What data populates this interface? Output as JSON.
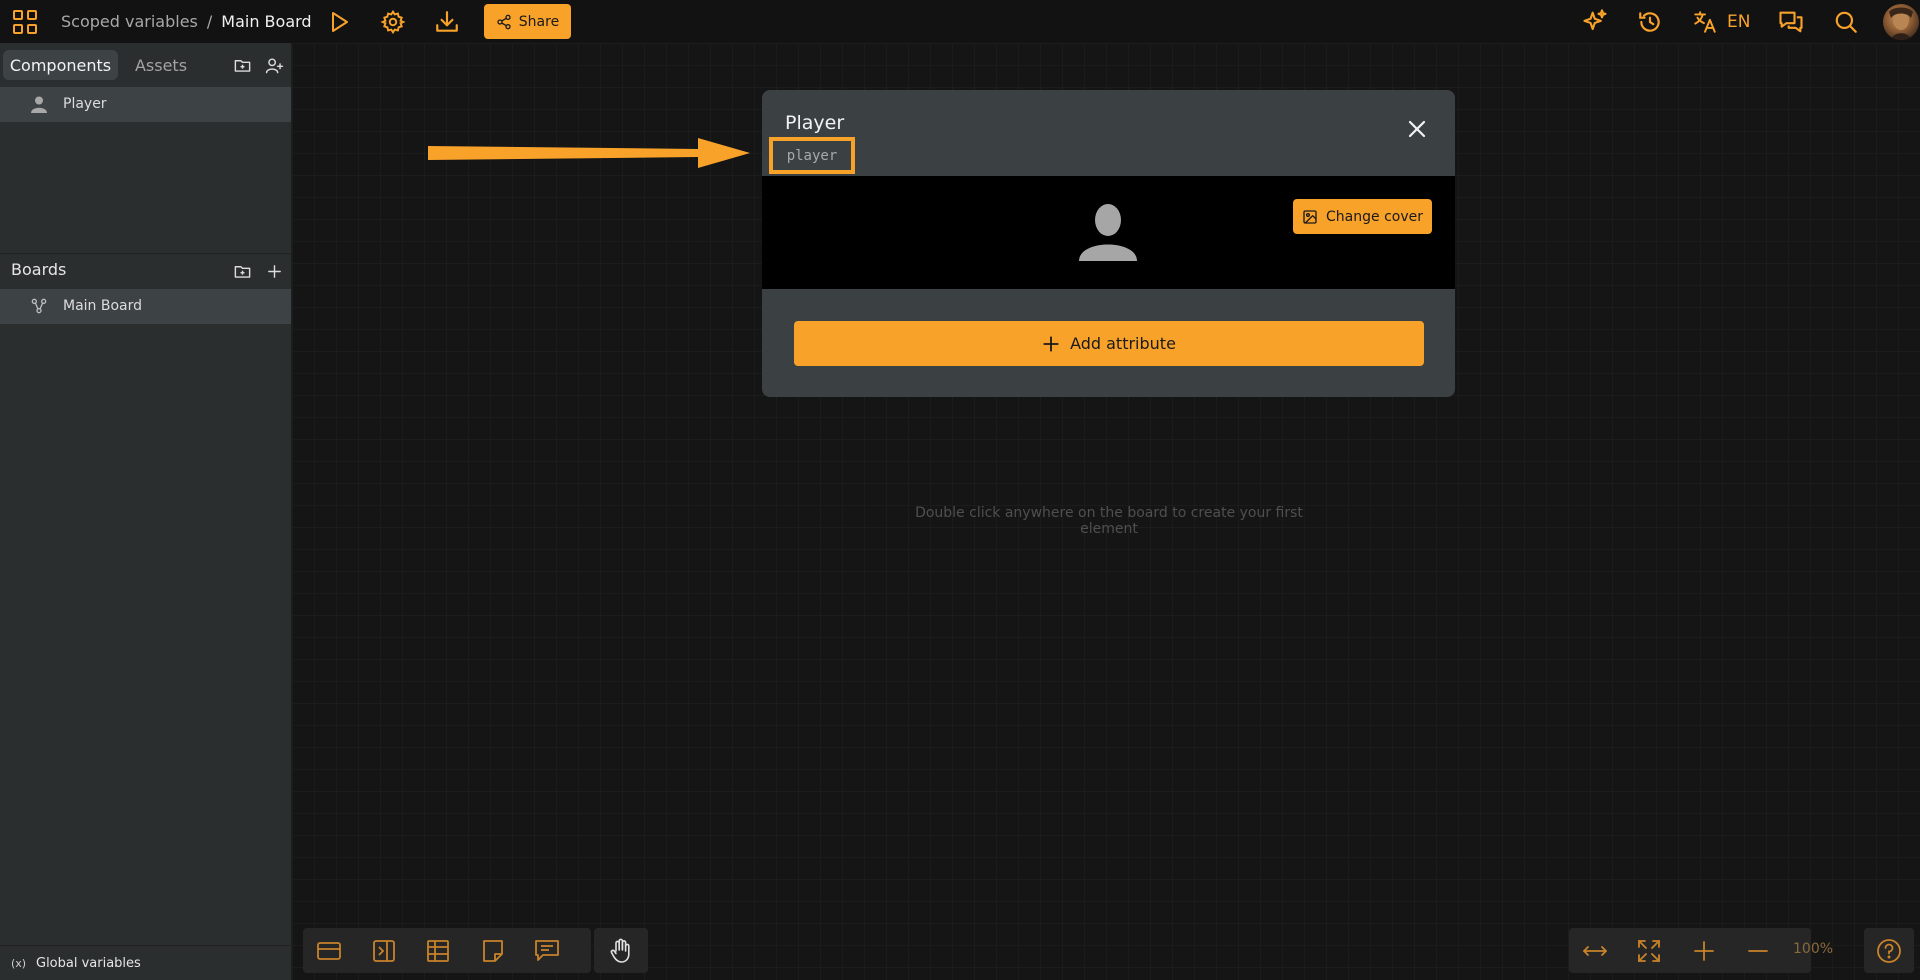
{
  "topbar": {
    "project_name": "Scoped variables",
    "separator": "/",
    "board_name": "Main Board",
    "share_label": "Share",
    "language": "EN",
    "icons": [
      "apps-grid-icon",
      "play-icon",
      "gear-icon",
      "download-icon",
      "share-icon",
      "sparkles-icon",
      "history-icon",
      "translate-icon",
      "chat-icon",
      "search-icon"
    ]
  },
  "sidebar": {
    "tabs": [
      {
        "label": "Components",
        "active": true
      },
      {
        "label": "Assets",
        "active": false
      }
    ],
    "components": [
      {
        "label": "Player",
        "icon": "person-icon"
      }
    ],
    "boards_title": "Boards",
    "boards": [
      {
        "label": "Main Board",
        "icon": "board-tree-icon"
      }
    ],
    "global_variables_icon": "(x)",
    "global_variables_label": "Global variables"
  },
  "canvas": {
    "empty_hint": "Double click anywhere on the board to create your first element"
  },
  "modal": {
    "title": "Player",
    "code": "player",
    "change_cover_label": "Change cover",
    "add_attribute_label": "Add attribute"
  },
  "bottom_toolbar": {
    "tools": [
      "card-icon",
      "sidebar-panel-icon",
      "table-icon",
      "note-icon",
      "comment-icon"
    ],
    "hand_tool": "hand-icon",
    "zoom_level": "100%",
    "zoom_tools": [
      "fit-width-icon",
      "fullscreen-icon",
      "zoom-in-icon",
      "zoom-out-icon"
    ],
    "help_icon": "help-icon"
  },
  "colors": {
    "accent": "#f9a22a",
    "sidebar_bg": "#2b2e2f",
    "canvas_bg": "#151515",
    "modal_bg": "#3b4043"
  }
}
